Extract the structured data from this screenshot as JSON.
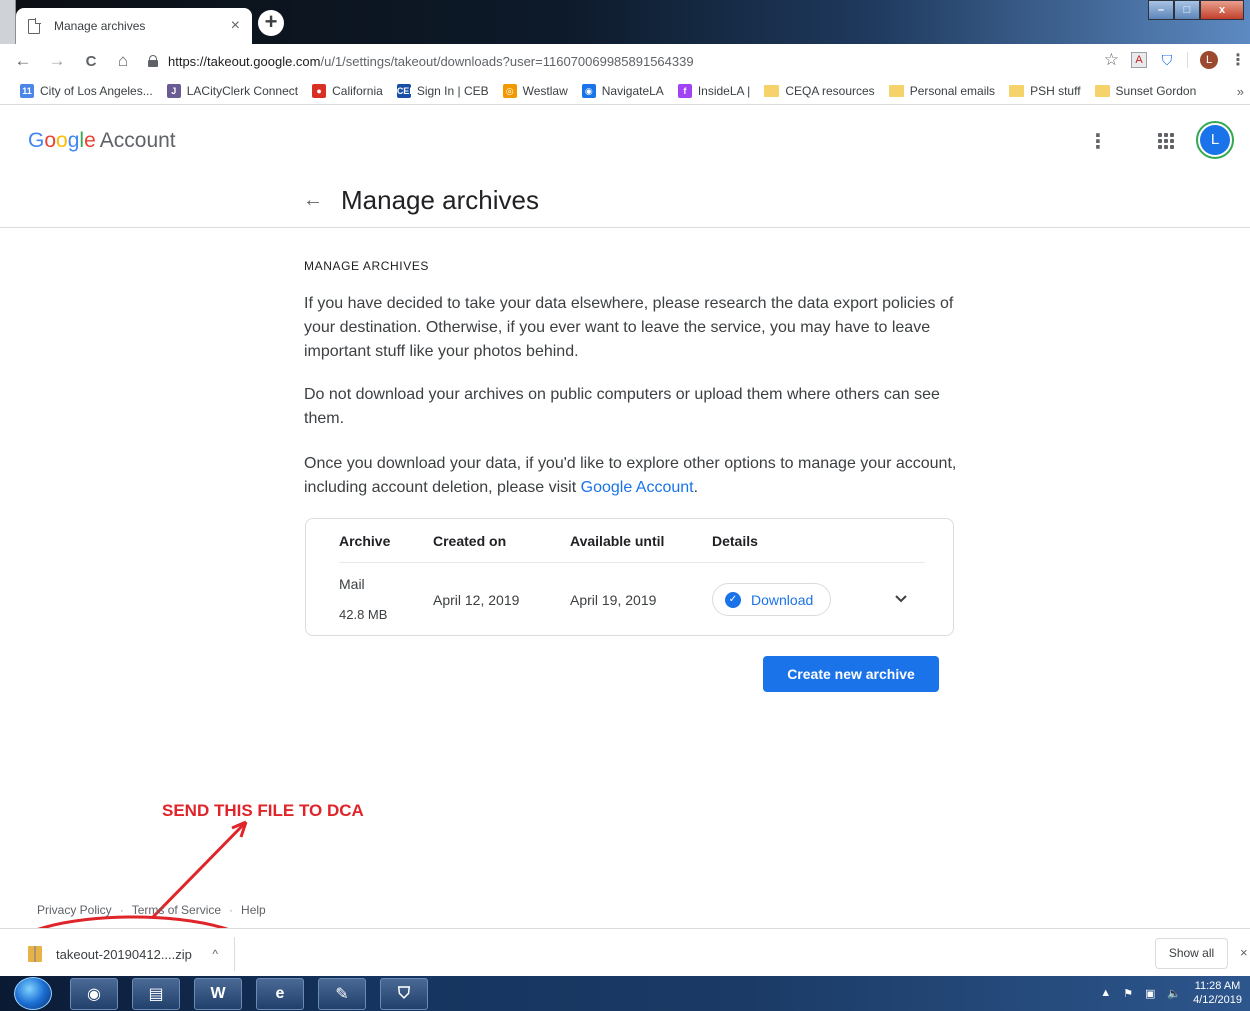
{
  "browser": {
    "tab_title": "Manage archives",
    "tab_close": "×",
    "new_tab": "+",
    "window_buttons": {
      "minimize": "–",
      "maximize": "□",
      "close": "x"
    },
    "nav": {
      "back": "←",
      "forward": "→",
      "reload": "C",
      "home": "⌂"
    },
    "url_host": "https://takeout.google.com",
    "url_path": "/u/1/settings/takeout/downloads?user=116070069985891564339",
    "profile_initial": "L",
    "bookmarks": [
      {
        "label": "City of Los Angeles...",
        "icon": "calendar-icon",
        "color": "#4a86e8",
        "glyph": "11"
      },
      {
        "label": "LACityClerk Connect",
        "icon": "clerk-icon",
        "color": "#6b5b95",
        "glyph": "J"
      },
      {
        "label": "California",
        "icon": "california-icon",
        "color": "#d93025",
        "glyph": "●"
      },
      {
        "label": "Sign In | CEB",
        "icon": "ceb-icon",
        "color": "#174ea6",
        "glyph": "CEB"
      },
      {
        "label": "Westlaw",
        "icon": "westlaw-icon",
        "color": "#f29900",
        "glyph": "◎"
      },
      {
        "label": "NavigateLA",
        "icon": "navigatela-icon",
        "color": "#1a73e8",
        "glyph": "◉"
      },
      {
        "label": "InsideLA |",
        "icon": "insidela-icon",
        "color": "#a142f4",
        "glyph": "f"
      },
      {
        "label": "CEQA resources",
        "icon": "folder-icon",
        "color": "#f5d36a",
        "glyph": ""
      },
      {
        "label": "Personal emails",
        "icon": "folder-icon",
        "color": "#f5d36a",
        "glyph": ""
      },
      {
        "label": "PSH stuff",
        "icon": "folder-icon",
        "color": "#f5d36a",
        "glyph": ""
      },
      {
        "label": "Sunset Gordon",
        "icon": "folder-icon",
        "color": "#f5d36a",
        "glyph": ""
      }
    ],
    "bookmarks_more": "»"
  },
  "header": {
    "logo_letters": [
      "G",
      "o",
      "o",
      "g",
      "l",
      "e"
    ],
    "logo_suffix": "Account",
    "avatar_initial": "L"
  },
  "page": {
    "back": "←",
    "title": "Manage archives",
    "section_label": "MANAGE ARCHIVES",
    "para1": "If you have decided to take your data elsewhere, please research the data export policies of your destination. Otherwise, if you ever want to leave the service, you may have to leave important stuff like your photos behind.",
    "para2": "Do not download your archives on public computers or upload them where others can see them.",
    "para3_before": "Once you download your data, if you'd like to explore other options to manage your account, including account deletion, please visit ",
    "para3_link": "Google Account",
    "para3_after": "."
  },
  "table": {
    "headers": [
      "Archive",
      "Created on",
      "Available until",
      "Details"
    ],
    "row": {
      "archive": "Mail",
      "size": "42.8 MB",
      "created": "April 12, 2019",
      "available_until": "April 19, 2019",
      "download_label": "Download"
    }
  },
  "create_button": "Create new archive",
  "annotation": "SEND THIS FILE TO DCA",
  "footer": {
    "privacy": "Privacy Policy",
    "terms": "Terms of Service",
    "help": "Help",
    "dot": "·"
  },
  "downloads": {
    "file_name": "takeout-20190412....zip",
    "chevron": "^",
    "show_all": "Show all",
    "close": "×"
  },
  "taskbar": {
    "time": "11:28 AM",
    "date": "4/12/2019"
  },
  "colors": {
    "accent": "#1a73e8",
    "annotation_red": "#e0252a"
  }
}
